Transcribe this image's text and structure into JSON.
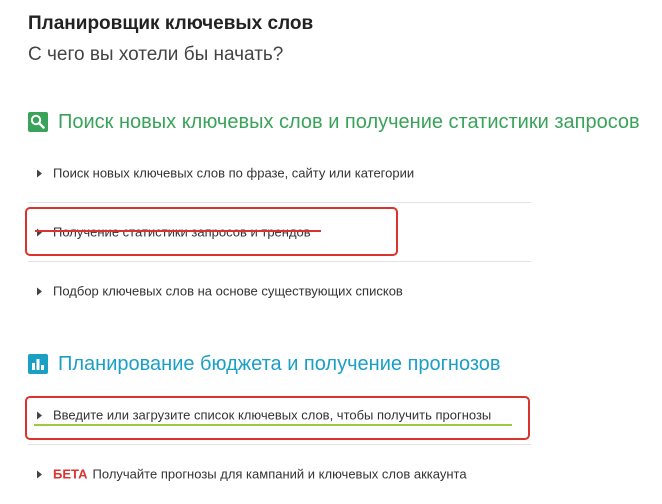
{
  "page": {
    "title": "Планировщик ключевых слов",
    "subtitle": "С чего вы хотели бы начать?"
  },
  "sections": [
    {
      "title": "Поиск новых ключевых слов и получение статистики запросов",
      "icon": "search-icon",
      "color": "#3aa35a",
      "options": [
        {
          "label": "Поиск новых ключевых слов по фразе, сайту или категории"
        },
        {
          "label": "Получение статистики запросов и трендов"
        },
        {
          "label": "Подбор ключевых слов на основе существующих списков"
        }
      ]
    },
    {
      "title": "Планирование бюджета и получение прогнозов",
      "icon": "bar-chart-icon",
      "color": "#1a9fc5",
      "options": [
        {
          "label": "Введите или загрузите список ключевых слов, чтобы получить прогнозы"
        },
        {
          "badge": "БЕТА",
          "label": "Получайте прогнозы для кампаний и ключевых слов аккаунта"
        }
      ]
    }
  ],
  "colors": {
    "annotation_red": "#d9342b",
    "annotation_green": "#9ccc3c",
    "beta_red": "#dd3333"
  }
}
